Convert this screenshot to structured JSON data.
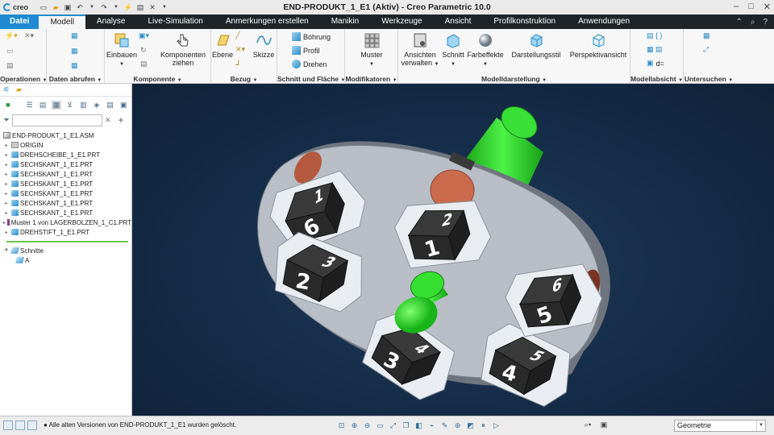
{
  "app": {
    "logo_text": "creo",
    "window_title": "END-PRODUKT_1_E1 (Aktiv) - Creo Parametric 10.0"
  },
  "ribbon_tabs": [
    {
      "label": "Datei"
    },
    {
      "label": "Modell"
    },
    {
      "label": "Analyse"
    },
    {
      "label": "Live-Simulation"
    },
    {
      "label": "Anmerkungen erstellen"
    },
    {
      "label": "Manikin"
    },
    {
      "label": "Werkzeuge"
    },
    {
      "label": "Ansicht"
    },
    {
      "label": "Profilkonstruktion"
    },
    {
      "label": "Anwendungen"
    }
  ],
  "groups": {
    "operationen": "Operationen",
    "daten_abrufen": "Daten abrufen",
    "komponente": "Komponente",
    "bezug": "Bezug",
    "schnitt_flaeche": "Schnitt und Fläche",
    "modifikatoren": "Modifikatoren",
    "modelldarstellung": "Modelldarstellung",
    "modellabsicht": "Modellabsicht",
    "untersuchen": "Untersuchen"
  },
  "buttons": {
    "einbauen": "Einbauen",
    "komponenten_ziehen_1": "Komponenten",
    "komponenten_ziehen_2": "ziehen",
    "ebene": "Ebene",
    "skizze": "Skizze",
    "bohrung": "Bohrung",
    "profil": "Profil",
    "drehen": "Drehen",
    "muster": "Muster",
    "ansichten_1": "Ansichten",
    "ansichten_2": "verwalten",
    "schnitt": "Schnitt",
    "farbeffekte": "Farbeffekte",
    "darstellungsstil": "Darstellungsstil",
    "perspektivansicht": "Perspektivansicht",
    "d_label": "d="
  },
  "tree": {
    "root": "END-PRODUKT_1_E1.ASM",
    "items": [
      {
        "label": "ORIGIN",
        "icon": "origin"
      },
      {
        "label": "DREHSCHEIBE_1_E1.PRT",
        "icon": "part"
      },
      {
        "label": "SECHSKANT_1_E1.PRT",
        "icon": "part"
      },
      {
        "label": "SECHSKANT_1_E1.PRT",
        "icon": "part"
      },
      {
        "label": "SECHSKANT_1_E1.PRT",
        "icon": "part"
      },
      {
        "label": "SECHSKANT_1_E1.PRT",
        "icon": "part"
      },
      {
        "label": "SECHSKANT_1_E1.PRT",
        "icon": "part"
      },
      {
        "label": "SECHSKANT_1_E1.PRT",
        "icon": "part"
      },
      {
        "label": "Muster 1 von LAGERBOLZEN_1_C1.PRT",
        "icon": "pattern"
      },
      {
        "label": "DREHSTIFT_1_E1.PRT",
        "icon": "part"
      }
    ],
    "sections_title": "Schnitte",
    "sections": [
      {
        "label": "A"
      }
    ]
  },
  "status": {
    "message": "Alle alten Versionen von END-PRODUKT_1_E1 wurden gelöscht.",
    "filter_value": "Geometrie"
  },
  "model": {
    "dice_labels": [
      "6",
      "1",
      "2",
      "3",
      "4",
      "5"
    ],
    "colors": {
      "disc": "#b9bec6",
      "pin": "#2ee02a",
      "pad": "#c96a4c",
      "cube": "#2a2a2a",
      "background": "#142b46",
      "accent": "#1f8ad0"
    }
  }
}
